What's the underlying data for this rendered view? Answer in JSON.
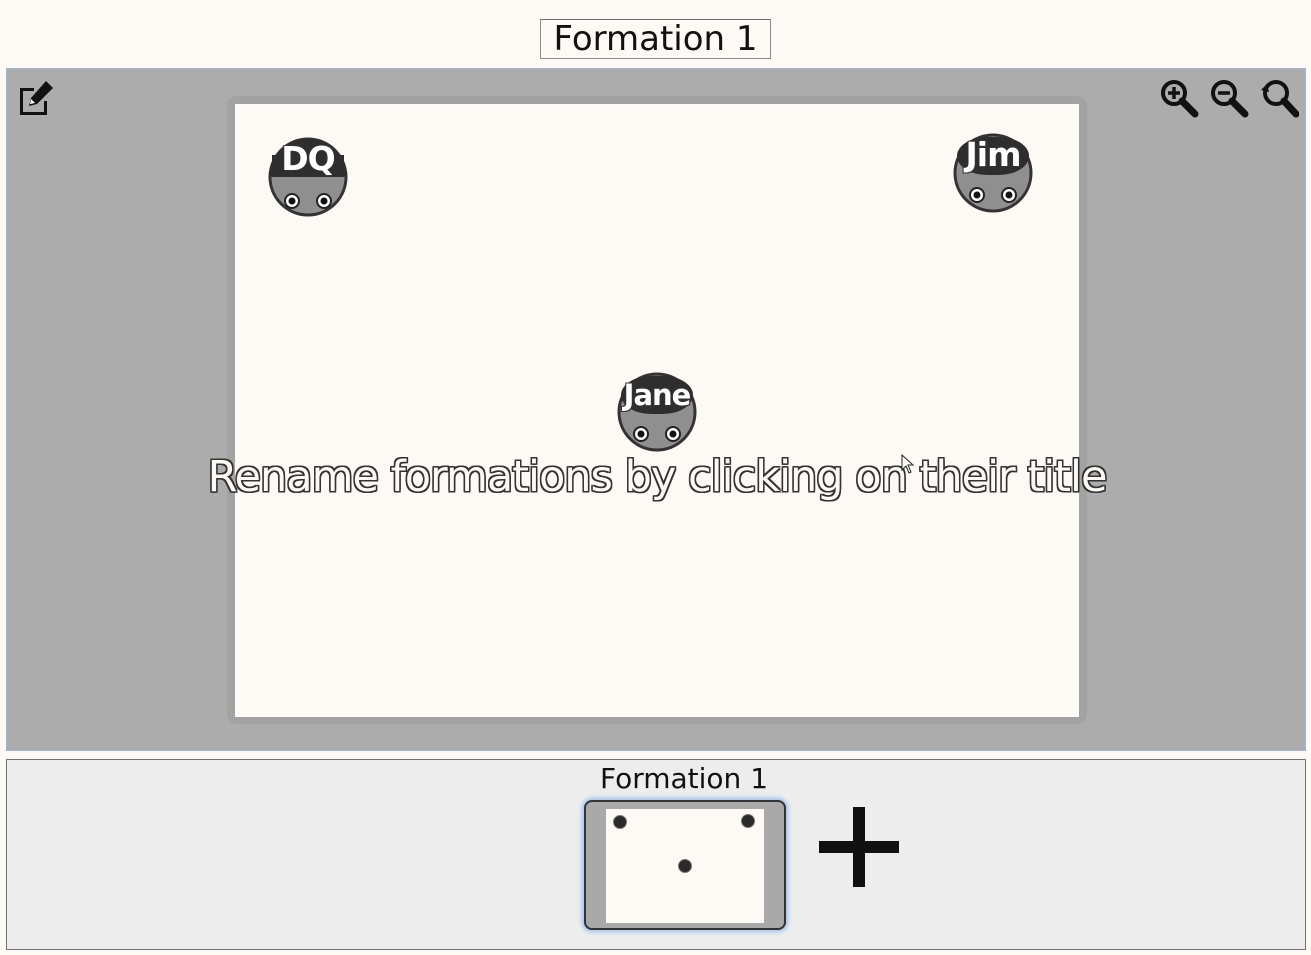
{
  "formation": {
    "title": "Formation 1"
  },
  "toolbar": {
    "edit_icon": "edit-pencil-icon",
    "zoom_in_icon": "zoom-in-icon",
    "zoom_out_icon": "zoom-out-icon",
    "zoom_reset_icon": "zoom-reset-icon"
  },
  "stage": {
    "hint": "Rename formations by clicking on their title",
    "dancers": [
      {
        "label": "DQ"
      },
      {
        "label": "Jim"
      },
      {
        "label": "Jane"
      }
    ]
  },
  "strip": {
    "thumbnails": [
      {
        "title": "Formation 1"
      }
    ],
    "add_icon": "plus-icon"
  },
  "colors": {
    "background": "#fdfaf5",
    "stage_bg": "#acacac",
    "dancer_dark": "#2e2e2e",
    "selection_glow": "#9cc0f0"
  }
}
